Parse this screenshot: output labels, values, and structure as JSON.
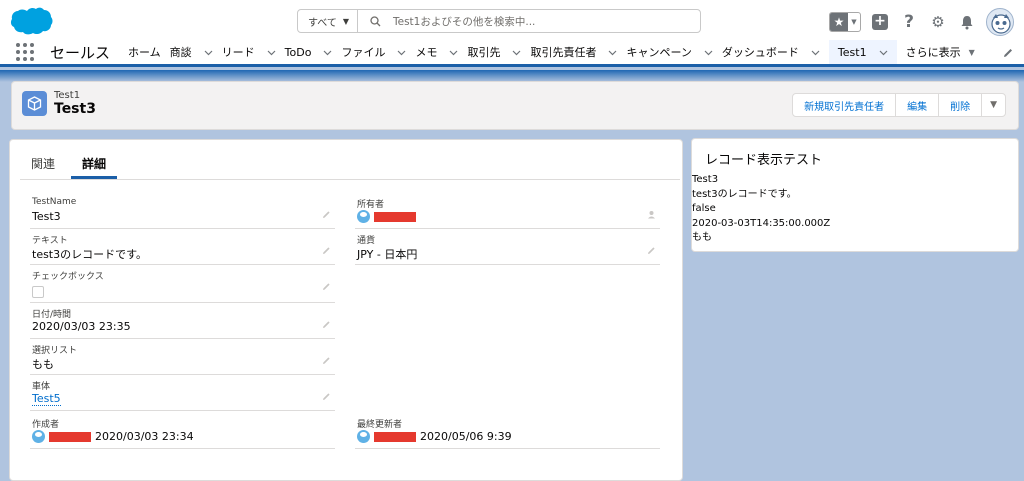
{
  "header": {
    "search_scope": "すべて",
    "search_placeholder": "Test1およびその他を検索中..."
  },
  "nav": {
    "app_name": "セールス",
    "items": [
      {
        "label": "ホーム",
        "chevron": false
      },
      {
        "label": "商談",
        "chevron": true
      },
      {
        "label": "リード",
        "chevron": true
      },
      {
        "label": "ToDo",
        "chevron": true
      },
      {
        "label": "ファイル",
        "chevron": true
      },
      {
        "label": "メモ",
        "chevron": true
      },
      {
        "label": "取引先",
        "chevron": true
      },
      {
        "label": "取引先責任者",
        "chevron": true
      },
      {
        "label": "キャンペーン",
        "chevron": true
      },
      {
        "label": "ダッシュボード",
        "chevron": true
      },
      {
        "label": "Test1",
        "chevron": true,
        "active": true
      }
    ],
    "more_label": "さらに表示"
  },
  "record": {
    "type": "Test1",
    "name": "Test3",
    "buttons": [
      "新規取引先責任者",
      "編集",
      "削除"
    ]
  },
  "tabs": [
    "関連",
    "詳細"
  ],
  "fields": {
    "testname": {
      "label": "TestName",
      "value": "Test3"
    },
    "text": {
      "label": "テキスト",
      "value": "test3のレコードです。"
    },
    "checkbox": {
      "label": "チェックボックス"
    },
    "datetime": {
      "label": "日付/時間",
      "value": "2020/03/03 23:35"
    },
    "picklist": {
      "label": "選択リスト",
      "value": "もも"
    },
    "car": {
      "label": "車体",
      "value": "Test5"
    },
    "created_by": {
      "label": "作成者",
      "value": "2020/03/03 23:34"
    },
    "owner": {
      "label": "所有者"
    },
    "currency": {
      "label": "通貨",
      "value": "JPY - 日本円"
    },
    "modified_by": {
      "label": "最終更新者",
      "value": "2020/05/06 9:39"
    }
  },
  "side": {
    "title": "レコード表示テスト",
    "lines": [
      "Test3",
      "test3のレコードです。",
      "false",
      "2020-03-03T14:35:00.000Z",
      "もも"
    ]
  }
}
